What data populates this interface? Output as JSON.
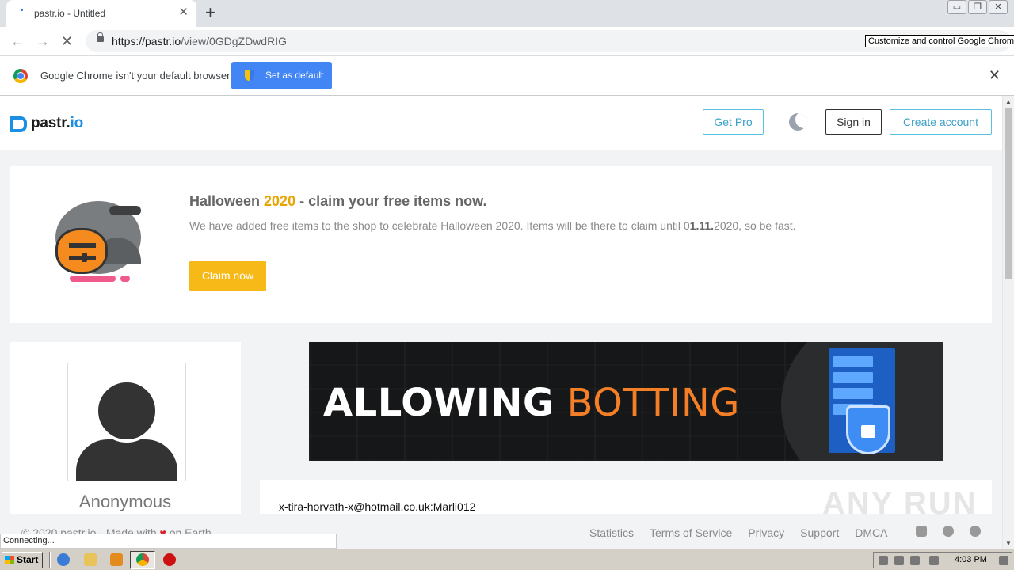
{
  "browser": {
    "tab_title": "pastr.io - Untitled",
    "tab_close": "✕",
    "new_tab": "+",
    "url_host": "https://pastr.io",
    "url_path": "/view/0GDgZDwdRIG",
    "tooltip": "Customize and control Google Chrome",
    "back": "←",
    "forward": "→",
    "stop": "✕",
    "window_controls": [
      "▭",
      "❐",
      "✕"
    ]
  },
  "infobar": {
    "message": "Google Chrome isn't your default browser",
    "set_default_label": "Set as default",
    "close": "✕"
  },
  "site": {
    "logo_name": "pastr.",
    "logo_tld": "io",
    "get_pro": "Get Pro",
    "sign_in": "Sign in",
    "create_account": "Create account"
  },
  "promo": {
    "title_pre": "Halloween ",
    "title_year": "2020",
    "title_post": " - claim your free items now.",
    "desc_pre": "We have added free items to the shop to celebrate Halloween 2020. Items will be there to claim until 0",
    "desc_bold": "1.11.",
    "desc_post": "2020, so be fast.",
    "claim_label": "Claim now"
  },
  "profile": {
    "username": "Anonymous"
  },
  "banner": {
    "word1": "ALLOWING",
    "word2": "BOTTING"
  },
  "paste": {
    "line1": "x-tira-horvath-x@hotmail.co.uk:Marli012"
  },
  "footer": {
    "copyright_pre": "© 2020 pastr.io - Made with ",
    "copyright_post": " on Earth",
    "links": [
      "Statistics",
      "Terms of Service",
      "Privacy",
      "Support",
      "DMCA"
    ]
  },
  "status": {
    "text": "Connecting..."
  },
  "watermark": "ANY RUN",
  "taskbar": {
    "start_label": "Start",
    "clock": "4:03 PM"
  }
}
